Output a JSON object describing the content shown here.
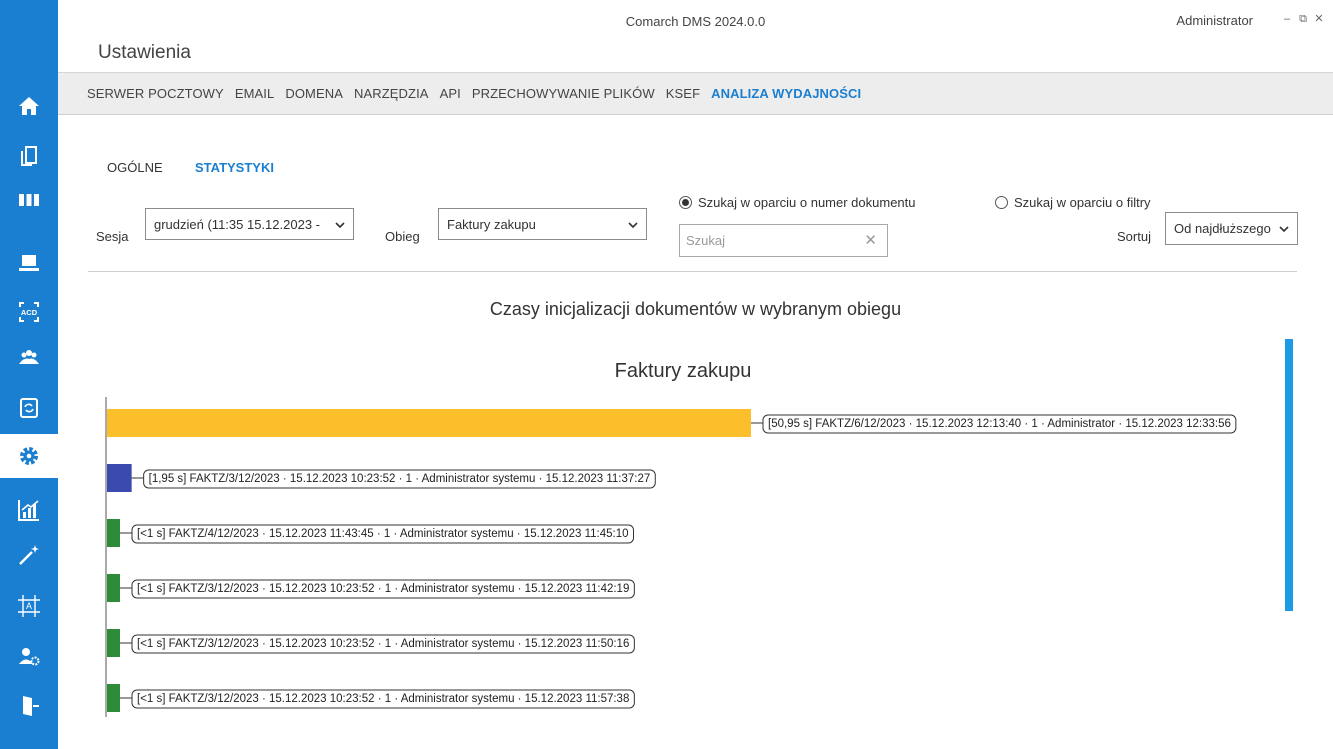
{
  "window": {
    "app_title": "Comarch DMS 2024.0.0",
    "user": "Administrator",
    "minimize_glyph": "–",
    "restore_glyph": "⧉",
    "close_glyph": "✕"
  },
  "page": {
    "title": "Ustawienia"
  },
  "sidebar": {
    "accent": "#1a7fd0",
    "items": [
      {
        "icon": "home-icon",
        "active": false
      },
      {
        "icon": "documents-icon",
        "active": false
      },
      {
        "icon": "workflow-icon",
        "active": false
      },
      {
        "icon": "laptop-icon",
        "active": false
      },
      {
        "icon": "ocr-acd-icon",
        "active": false
      },
      {
        "icon": "users-icon",
        "active": false
      },
      {
        "icon": "sync-document-icon",
        "active": false
      },
      {
        "icon": "settings-gear-icon",
        "active": true
      },
      {
        "icon": "statistics-icon",
        "active": false
      },
      {
        "icon": "magic-wand-icon",
        "active": false
      },
      {
        "icon": "template-designer-icon",
        "active": false
      },
      {
        "icon": "user-settings-icon",
        "active": false
      },
      {
        "icon": "logout-door-icon",
        "active": false
      }
    ]
  },
  "topnav": {
    "items": [
      {
        "label": "SERWER POCZTOWY",
        "active": false
      },
      {
        "label": "EMAIL",
        "active": false
      },
      {
        "label": "DOMENA",
        "active": false
      },
      {
        "label": "NARZĘDZIA",
        "active": false
      },
      {
        "label": "API",
        "active": false
      },
      {
        "label": "PRZECHOWYWANIE PLIKÓW",
        "active": false
      },
      {
        "label": "KSEF",
        "active": false
      },
      {
        "label": "ANALIZA WYDAJNOŚCI",
        "active": true
      }
    ]
  },
  "subtabs": {
    "general": "OGÓLNE",
    "stats": "STATYSTYKI"
  },
  "filters": {
    "session_label": "Sesja",
    "session_value": "grudzień (11:35 15.12.2023 -",
    "flow_label": "Obieg",
    "flow_value": "Faktury zakupu",
    "radio_number": "Szukaj w oparciu o numer dokumentu",
    "radio_filters": "Szukaj w oparciu o filtry",
    "search_placeholder": "Szukaj",
    "search_clear": "✕",
    "sort_label": "Sortuj",
    "sort_value": "Od najdłuższego"
  },
  "chart_caption": "Czasy inicjalizacji dokumentów w wybranym obiegu",
  "chart_data": {
    "type": "bar",
    "orientation": "horizontal",
    "title": "Faktury zakupu",
    "unit": "s",
    "max_value": 50.95,
    "bars": [
      {
        "value": 50.95,
        "color": "#fbbf2c",
        "label": "[50,95 s] FAKTZ/6/12/2023 · 15.12.2023 12:13:40 · 1 · Administrator · 15.12.2023 12:33:56"
      },
      {
        "value": 1.95,
        "color": "#3b4bad",
        "label": "[1,95 s] FAKTZ/3/12/2023 · 15.12.2023 10:23:52 · 1 · Administrator systemu · 15.12.2023 11:37:27"
      },
      {
        "value": 1.0,
        "color": "#2e8b38",
        "label": "[<1 s] FAKTZ/4/12/2023 · 15.12.2023 11:43:45 · 1 · Administrator systemu · 15.12.2023 11:45:10"
      },
      {
        "value": 1.0,
        "color": "#2e8b38",
        "label": "[<1 s] FAKTZ/3/12/2023 · 15.12.2023 10:23:52 · 1 · Administrator systemu · 15.12.2023 11:42:19"
      },
      {
        "value": 1.0,
        "color": "#2e8b38",
        "label": "[<1 s] FAKTZ/3/12/2023 · 15.12.2023 10:23:52 · 1 · Administrator systemu · 15.12.2023 11:50:16"
      },
      {
        "value": 1.0,
        "color": "#2e8b38",
        "label": "[<1 s] FAKTZ/3/12/2023 · 15.12.2023 10:23:52 · 1 · Administrator systemu · 15.12.2023 11:57:38"
      }
    ]
  }
}
